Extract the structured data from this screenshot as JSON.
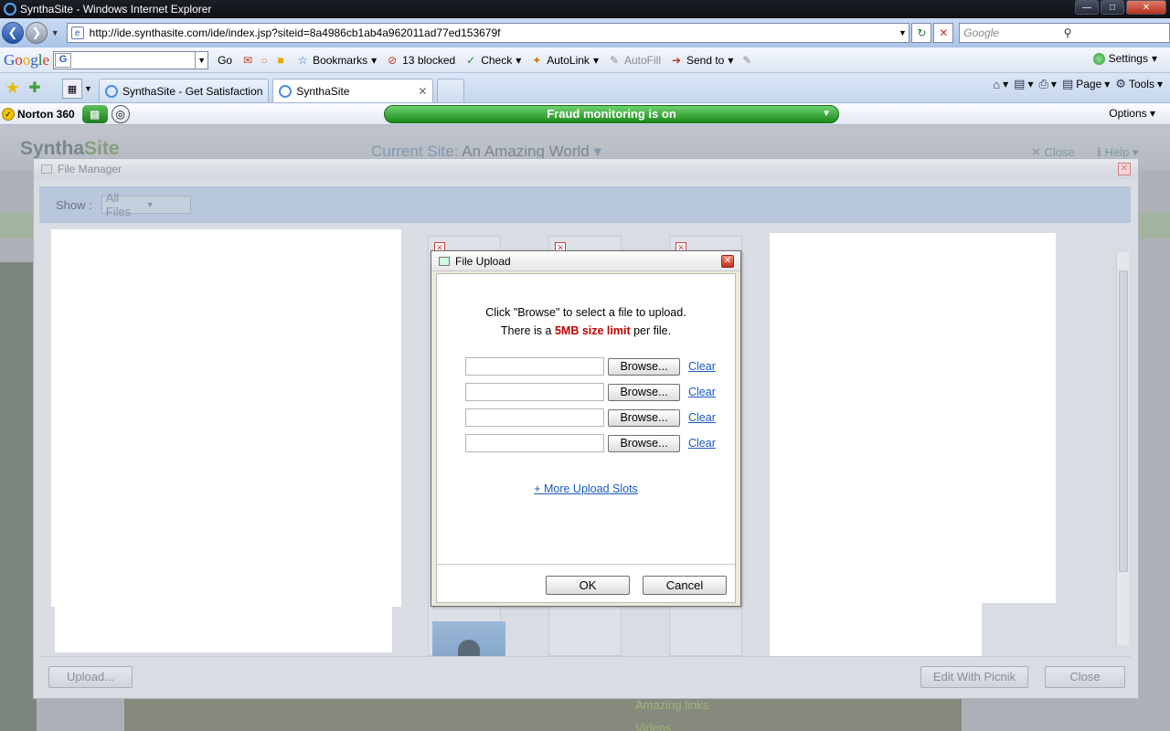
{
  "window": {
    "title": "SynthaSite - Windows Internet Explorer",
    "controls": [
      "minimize",
      "maximize",
      "close"
    ]
  },
  "address_bar": {
    "url": "http://ide.synthasite.com/ide/index.jsp?siteid=8a4986cb1ab4a962011ad77ed153679f",
    "search_placeholder": "Google"
  },
  "google_toolbar": {
    "logo": "Google",
    "go_label": "Go",
    "bookmarks_label": "Bookmarks",
    "blocked_label": "13 blocked",
    "check_label": "Check",
    "autolink_label": "AutoLink",
    "autofill_label": "AutoFill",
    "sendto_label": "Send to",
    "settings_label": "Settings"
  },
  "tabs": [
    {
      "label": "SynthaSite - Get Satisfaction",
      "active": false
    },
    {
      "label": "SynthaSite",
      "active": true
    }
  ],
  "command_bar": {
    "page_label": "Page",
    "tools_label": "Tools"
  },
  "norton_bar": {
    "brand": "Norton 360",
    "status": "Fraud monitoring is on",
    "options_label": "Options"
  },
  "synthasite": {
    "logo_part1": "Syntha",
    "logo_part2": "Site",
    "current_site_label": "Current Site:",
    "current_site_name": "An Amazing World",
    "close_label": "Close",
    "help_label": "Help",
    "sidebar_links": [
      "Amazing links",
      "Videos"
    ]
  },
  "file_manager": {
    "title": "File Manager",
    "show_label": "Show :",
    "show_value": "All Files",
    "upload_button": "Upload...",
    "picnik_button": "Edit With Picnik",
    "close_button": "Close"
  },
  "file_upload": {
    "title": "File Upload",
    "instruction_line1": "Click \"Browse\" to select a file to upload.",
    "instruction_prefix": "There is a",
    "limit_text": "5MB size limit",
    "instruction_suffix": "per file.",
    "rows": [
      {
        "browse": "Browse...",
        "clear": "Clear"
      },
      {
        "browse": "Browse...",
        "clear": "Clear"
      },
      {
        "browse": "Browse...",
        "clear": "Clear"
      },
      {
        "browse": "Browse...",
        "clear": "Clear"
      }
    ],
    "more_slots": "+ More Upload Slots",
    "ok_button": "OK",
    "cancel_button": "Cancel"
  }
}
